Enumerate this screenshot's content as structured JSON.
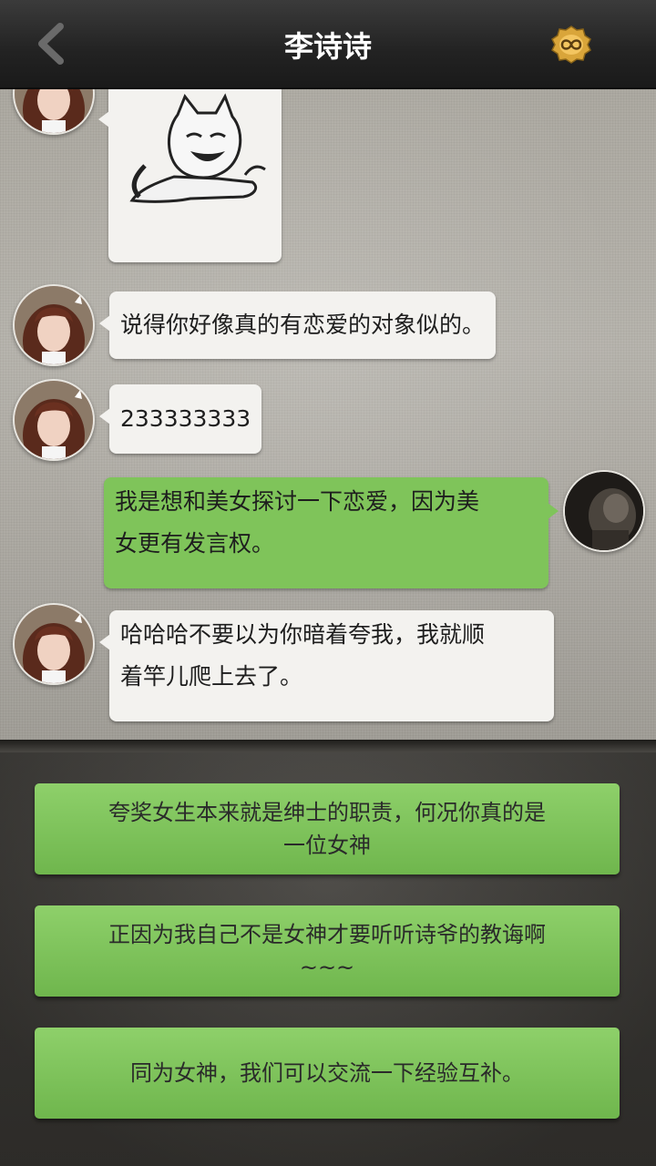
{
  "header": {
    "title": "李诗诗",
    "back_icon": "chevron-left-icon",
    "action_icon": "infinity-badge-icon"
  },
  "messages": [
    {
      "from": "contact",
      "type": "sticker",
      "sticker": "meme-cat-lounging"
    },
    {
      "from": "contact",
      "type": "text",
      "text": "说得你好像真的有恋爱的对象似的。"
    },
    {
      "from": "contact",
      "type": "text",
      "text": "233333333"
    },
    {
      "from": "me",
      "type": "text",
      "lines": [
        "我是想和美女探讨一下恋爱，因为美",
        "女更有发言权。"
      ]
    },
    {
      "from": "contact",
      "type": "text",
      "lines": [
        "哈哈哈不要以为你暗着夸我，我就顺",
        "着竿儿爬上去了。"
      ]
    }
  ],
  "options": [
    {
      "lines": [
        "夸奖女生本来就是绅士的职责，何况你真的是",
        "一位女神"
      ]
    },
    {
      "lines": [
        "正因为我自己不是女神才要听听诗爷的教诲啊",
        "~~~"
      ]
    },
    {
      "lines": [
        "同为女神，我们可以交流一下经验互补。"
      ]
    }
  ],
  "colors": {
    "header_bg": "#222222",
    "bubble_contact": "#f3f2ef",
    "bubble_me": "#7fc45a",
    "option_green": "#7cc25a"
  }
}
